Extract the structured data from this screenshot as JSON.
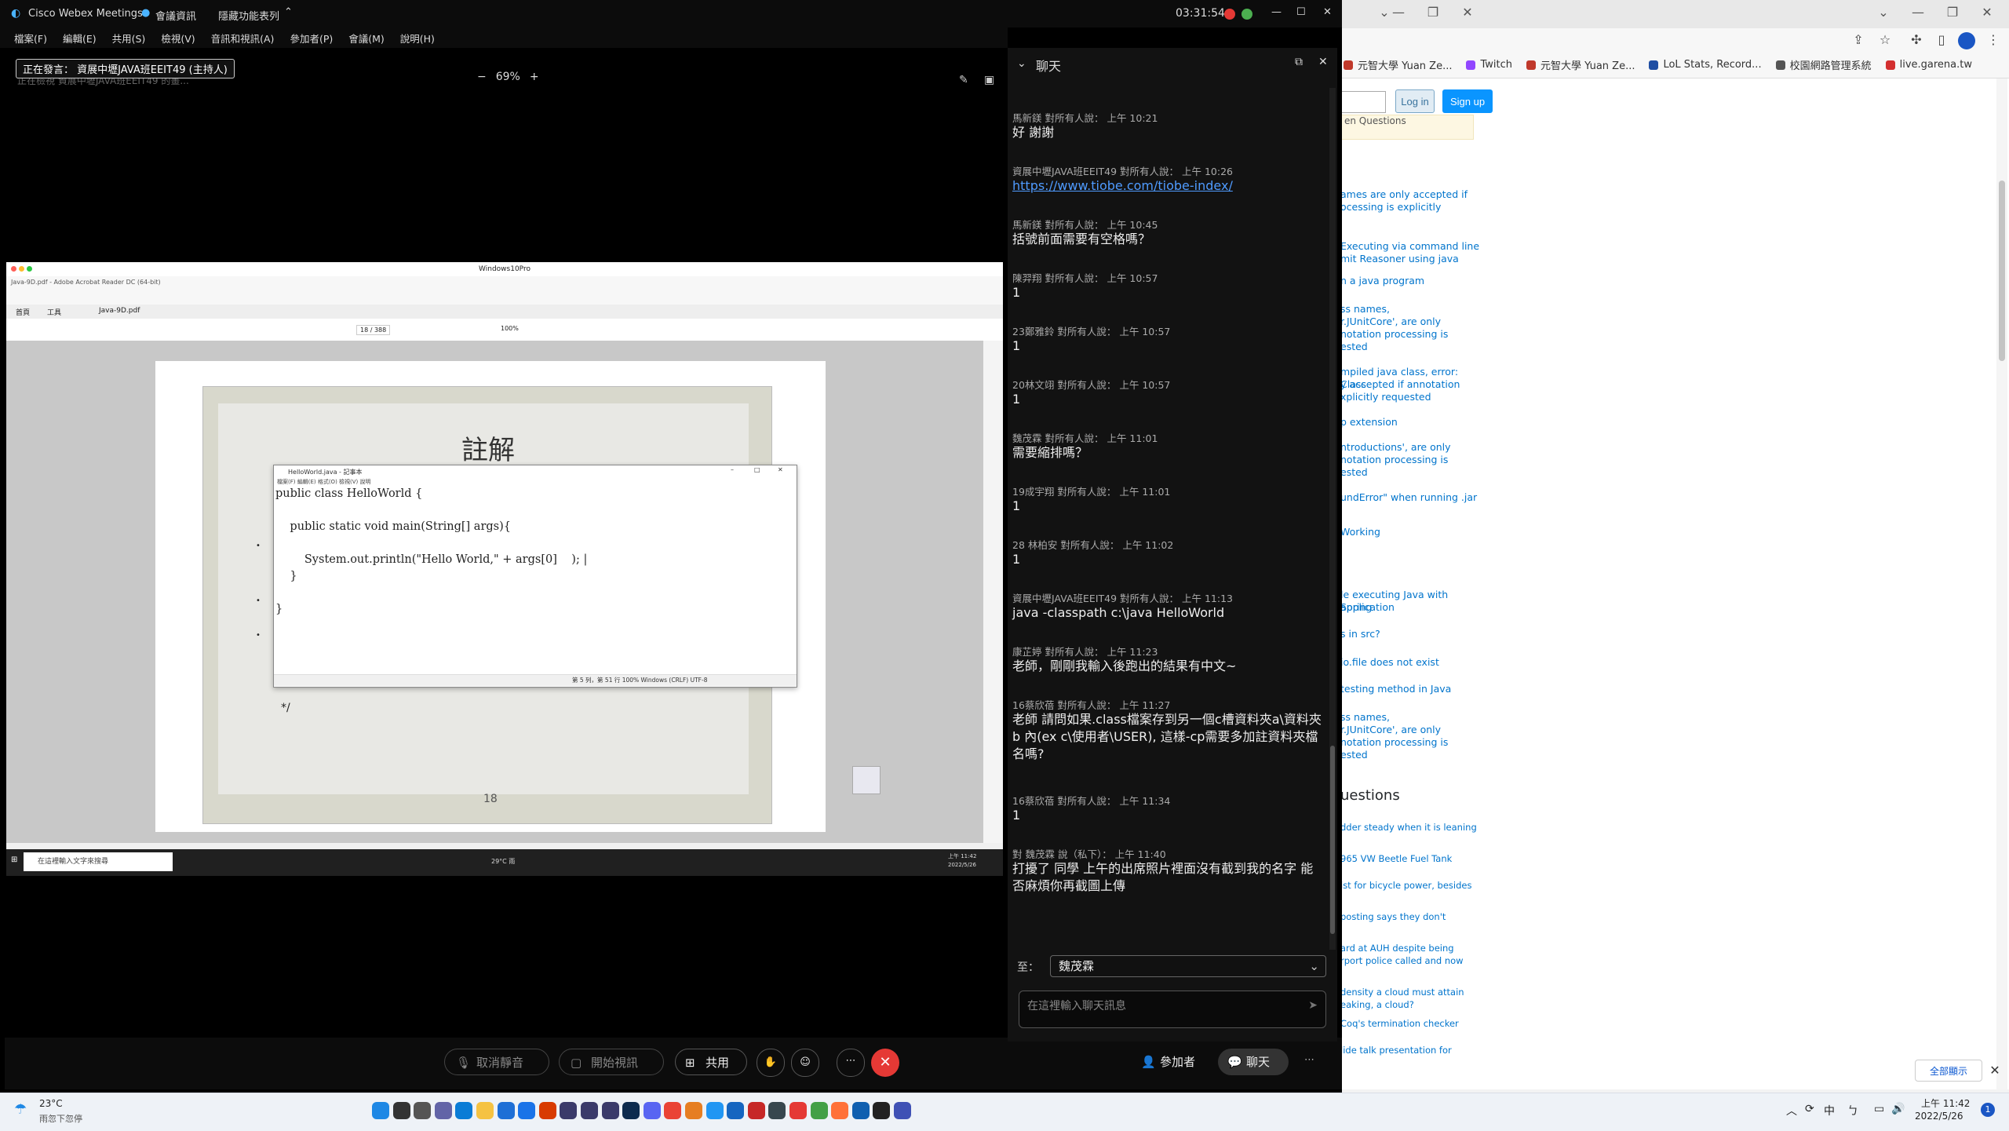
{
  "browser": {
    "bookmarks": [
      {
        "label": "元智大學 Yuan Ze...",
        "color": "#c0392b"
      },
      {
        "label": "Twitch",
        "color": "#9146ff"
      },
      {
        "label": "元智大學 Yuan Ze...",
        "color": "#c0392b"
      },
      {
        "label": "LoL Stats, Record...",
        "color": "#1f4ea3"
      },
      {
        "label": "校園網路管理系統",
        "color": "#555555"
      },
      {
        "label": "live.garena.tw",
        "color": "#d32f2f"
      }
    ],
    "login_label": "Log in",
    "signup_label": "Sign up",
    "box_text": "en Questions",
    "links": [
      "ames are only accepted if",
      "ocessing is explicitly",
      "Executing via command line",
      "mit Reasoner using java",
      "n a java program",
      "ss names,",
      "r.JUnitCore', are only",
      "notation processing is",
      "ested",
      "mpiled java class, error: Class",
      "y accepted if annotation",
      "xplicitly requested",
      "p extension",
      "ntroductions', are only",
      "notation processing is",
      "ested",
      "undError\" when running .jar",
      "Working",
      "le executing Java with Spring",
      " application",
      "s in src?",
      "io.file does not exist",
      "testing method in Java",
      "ss names,",
      "r.JUnitCore', are only",
      "notation processing is",
      "ested"
    ],
    "section_header": "uestions",
    "hot_links": [
      "dder steady when it is leaning",
      "965 VW Beetle Fuel Tank",
      "ist for bicycle power, besides",
      " posting says they don't",
      "ard at AUH despite being",
      "rport police called and now",
      "density a cloud must attain",
      "eaking, a cloud?",
      "Coq's termination checker",
      "lide talk presentation for"
    ],
    "fullscreen_label": "全部顯示"
  },
  "webex": {
    "app_title": "Cisco Webex Meetings",
    "meeting_info": "會議資訊",
    "hide_menu": "隱藏功能表列",
    "clock": "03:31:54",
    "menu": [
      "檔案(F)",
      "編輯(E)",
      "共用(S)",
      "檢視(V)",
      "音訊和視訊(A)",
      "參加者(P)",
      "會議(M)",
      "說明(H)"
    ],
    "sharing_tag": "正在發言： 資展中壢JAVA班EEIT49 (主持人)",
    "ghost_text": "正在檢視 資展中壢JAVA班EEIT49 的畫...",
    "zoom": "69%",
    "toolbar": {
      "mute": "取消靜音",
      "video": "開始視訊",
      "share": "共用",
      "participants": "參加者",
      "chat": "聊天"
    }
  },
  "remote": {
    "window_title": "Windows10Pro",
    "acrobat_title": "Java-9D.pdf - Adobe Acrobat Reader DC (64-bit)",
    "tabs": [
      "首頁",
      "工具",
      "Java-9D.pdf"
    ],
    "page_indicator": "18 / 388",
    "zoom": "100%",
    "slide_title": "註解",
    "slide_number": "18",
    "slide_comment": "*/",
    "notepad_title": "HelloWorld.java - 記事本",
    "notepad_menu": "檔案(F)  編輯(E)  格式(O)  檢視(V)  說明",
    "code_lines": [
      "public class HelloWorld {",
      "",
      "    public static void main(String[] args){",
      "",
      "        System.out.println(\"Hello World,\" + args[0]    ); |",
      "    }",
      "",
      "}"
    ],
    "notepad_status": "第 5 列，第 51 行          100%     Windows (CRLF)       UTF-8",
    "search_placeholder": "在這裡輸入文字來搜尋",
    "tray_weather": "29°C 雨",
    "tray_time": "上午 11:42",
    "tray_date": "2022/5/26"
  },
  "chat": {
    "title": "聊天",
    "messages": [
      {
        "meta": "馬新鎂 對所有人說：    上午 10:21",
        "body": "好 謝謝"
      },
      {
        "meta": "資展中壢JAVA班EEIT49 對所有人說：    上午 10:26",
        "body": "https://www.tiobe.com/tiobe-index/",
        "link": true
      },
      {
        "meta": "馬新鎂 對所有人說：    上午 10:45",
        "body": "括號前面需要有空格嗎？"
      },
      {
        "meta": "陳羿翔 對所有人說：    上午 10:57",
        "body": "1"
      },
      {
        "meta": "23鄭雅鈴 對所有人說：    上午 10:57",
        "body": "1"
      },
      {
        "meta": "20林文翊 對所有人說：    上午 10:57",
        "body": "1"
      },
      {
        "meta": "魏茂霖 對所有人說：    上午 11:01",
        "body": "需要縮排嗎？"
      },
      {
        "meta": "19成宇翔 對所有人說：    上午 11:01",
        "body": "1"
      },
      {
        "meta": "28 林柏安 對所有人說：    上午 11:02",
        "body": "1"
      },
      {
        "meta": "資展中壢JAVA班EEIT49 對所有人說：    上午 11:13",
        "body": "java -classpath c:\\java HelloWorld"
      },
      {
        "meta": "康芷婷 對所有人說：    上午 11:23",
        "body": "老師，剛剛我輸入後跑出的結果有中文~"
      },
      {
        "meta": "16蔡欣蓓 對所有人說：    上午 11:27",
        "body": "老師 請問如果.class檔案存到另一個c槽資料夾a\\資料夾b 內(ex c\\使用者\\USER), 這樣-cp需要多加註資料夾檔名嗎?"
      },
      {
        "meta": "16蔡欣蓓 對所有人說：    上午 11:34",
        "body": "1"
      },
      {
        "meta": "對 魏茂霖 說（私下）：    上午 11:40",
        "body": "打擾了 同學 上午的出席照片裡面沒有截到我的名字 能否麻煩你再截圖上傳"
      }
    ],
    "to_label": "至：",
    "to_value": "魏茂霖",
    "input_placeholder": "在這裡輸入聊天訊息"
  },
  "taskbar": {
    "weather_temp": "23°C",
    "weather_desc": "雨忽下忽停",
    "ime": "中",
    "time": "上午 11:42",
    "date": "2022/5/26",
    "notification_count": "1"
  }
}
